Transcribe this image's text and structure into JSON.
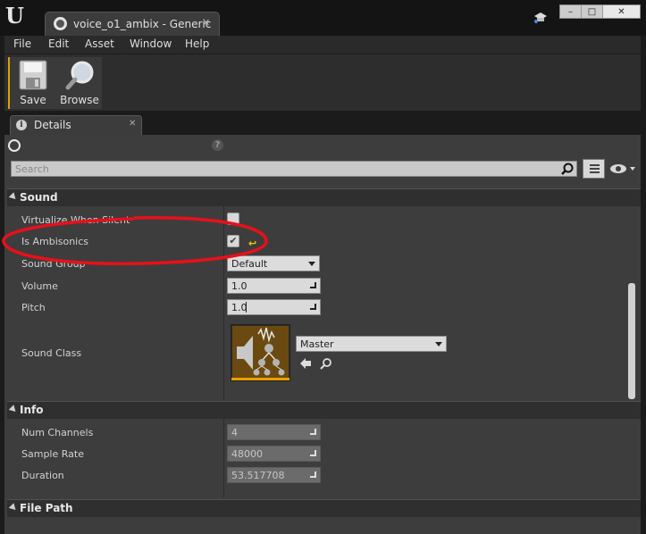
{
  "window": {
    "tab_title": "voice_o1_ambix - Generic",
    "tab_close": "✕",
    "app_logo": "U",
    "controls": {
      "minimize": "–",
      "maximize": "□",
      "close": "✕"
    }
  },
  "menu": [
    "File",
    "Edit",
    "Asset",
    "Window",
    "Help"
  ],
  "toolbar": {
    "save_label": "Save",
    "browse_label": "Browse"
  },
  "details_tab": {
    "label": "Details",
    "close": "✕",
    "icon": "i"
  },
  "search": {
    "placeholder": "Search",
    "help": "?"
  },
  "sections": {
    "sound": {
      "header": "Sound",
      "virtualize_label": "Virtualize When Silent",
      "ambisonics_label": "Is Ambisonics",
      "ambisonics_checked": true,
      "sound_group_label": "Sound Group",
      "sound_group_value": "Default",
      "volume_label": "Volume",
      "volume_value": "1.0",
      "pitch_label": "Pitch",
      "pitch_value": "1.0",
      "sound_class_label": "Sound Class",
      "sound_class_value": "Master"
    },
    "info": {
      "header": "Info",
      "num_channels_label": "Num Channels",
      "num_channels_value": "4",
      "sample_rate_label": "Sample Rate",
      "sample_rate_value": "48000",
      "duration_label": "Duration",
      "duration_value": "53.517708"
    },
    "file_path": {
      "header": "File Path"
    }
  },
  "colors": {
    "accent": "#d6a400",
    "annotation": "#e8101a",
    "panel_bg": "#3d3d3d"
  }
}
